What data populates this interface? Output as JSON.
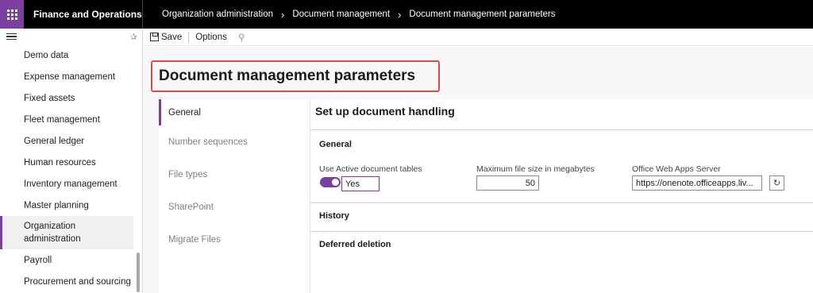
{
  "app": {
    "name": "Finance and Operations"
  },
  "breadcrumb": [
    "Organization administration",
    "Document management",
    "Document management parameters"
  ],
  "sidebar": {
    "items": [
      {
        "label": "Demo data"
      },
      {
        "label": "Expense management"
      },
      {
        "label": "Fixed assets"
      },
      {
        "label": "Fleet management"
      },
      {
        "label": "General ledger"
      },
      {
        "label": "Human resources"
      },
      {
        "label": "Inventory management"
      },
      {
        "label": "Master planning"
      },
      {
        "label": "Organization administration",
        "active": true
      },
      {
        "label": "Payroll"
      },
      {
        "label": "Procurement and sourcing"
      }
    ]
  },
  "toolbar": {
    "save_label": "Save",
    "options_label": "Options"
  },
  "page": {
    "title": "Document management parameters"
  },
  "tabs": [
    {
      "label": "General",
      "active": true
    },
    {
      "label": "Number sequences"
    },
    {
      "label": "File types"
    },
    {
      "label": "SharePoint"
    },
    {
      "label": "Migrate Files"
    }
  ],
  "panel": {
    "title": "Set up document handling",
    "general_group": "General",
    "use_active_label": "Use Active document tables",
    "use_active_value": "Yes",
    "max_size_label": "Maximum file size in megabytes",
    "max_size_value": "50",
    "office_label": "Office Web Apps Server",
    "office_value": "https://onenote.officeapps.liv...",
    "history_group": "History",
    "deferred_group": "Deferred deletion"
  },
  "colors": {
    "accent": "#7b3f9e",
    "highlight": "#e24a4a",
    "topbar": "#000000"
  },
  "icons": [
    "waffle-icon",
    "hamburger-icon",
    "pin-icon",
    "save-icon",
    "search-icon",
    "refresh-icon",
    "chevron-right-icon"
  ]
}
